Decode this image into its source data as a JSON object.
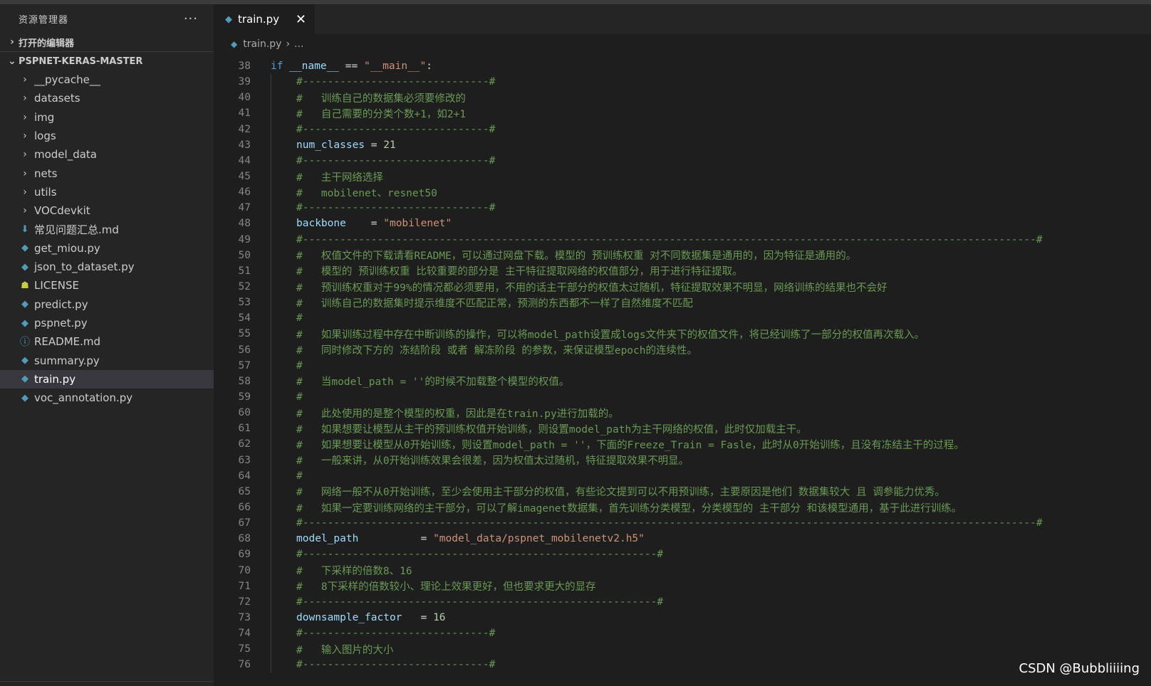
{
  "explorer": {
    "title": "资源管理器",
    "more": "···",
    "open_editors": "打开的编辑器",
    "project": "PSPNET-KERAS-MASTER",
    "items": [
      {
        "label": "__pycache__",
        "type": "folder"
      },
      {
        "label": "datasets",
        "type": "folder"
      },
      {
        "label": "img",
        "type": "folder"
      },
      {
        "label": "logs",
        "type": "folder"
      },
      {
        "label": "model_data",
        "type": "folder"
      },
      {
        "label": "nets",
        "type": "folder"
      },
      {
        "label": "utils",
        "type": "folder"
      },
      {
        "label": "VOCdevkit",
        "type": "folder"
      },
      {
        "label": "常见问题汇总.md",
        "type": "md"
      },
      {
        "label": "get_miou.py",
        "type": "py"
      },
      {
        "label": "json_to_dataset.py",
        "type": "py"
      },
      {
        "label": "LICENSE",
        "type": "license"
      },
      {
        "label": "predict.py",
        "type": "py"
      },
      {
        "label": "pspnet.py",
        "type": "py"
      },
      {
        "label": "README.md",
        "type": "info"
      },
      {
        "label": "summary.py",
        "type": "py"
      },
      {
        "label": "train.py",
        "type": "py",
        "active": true
      },
      {
        "label": "voc_annotation.py",
        "type": "py"
      }
    ]
  },
  "tab": {
    "label": "train.py",
    "close": "✕"
  },
  "breadcrumb": {
    "file": "train.py",
    "sep": "›",
    "rest": "..."
  },
  "code_lines": [
    {
      "n": "38",
      "indent": 0,
      "tokens": [
        [
          "k",
          "if "
        ],
        [
          "v",
          "__name__"
        ],
        [
          "o",
          " == "
        ],
        [
          "s",
          "\"__main__\""
        ],
        [
          "o",
          ":"
        ]
      ]
    },
    {
      "n": "39",
      "indent": 1,
      "tokens": [
        [
          "c",
          "#------------------------------#"
        ]
      ]
    },
    {
      "n": "40",
      "indent": 1,
      "tokens": [
        [
          "c",
          "#   训练自己的数据集必须要修改的"
        ]
      ]
    },
    {
      "n": "41",
      "indent": 1,
      "tokens": [
        [
          "c",
          "#   自己需要的分类个数+1，如2+1"
        ]
      ]
    },
    {
      "n": "42",
      "indent": 1,
      "tokens": [
        [
          "c",
          "#------------------------------#"
        ]
      ]
    },
    {
      "n": "43",
      "indent": 1,
      "tokens": [
        [
          "v",
          "num_classes"
        ],
        [
          "o",
          " = "
        ],
        [
          "n",
          "21"
        ]
      ]
    },
    {
      "n": "44",
      "indent": 1,
      "tokens": [
        [
          "c",
          "#------------------------------#"
        ]
      ]
    },
    {
      "n": "45",
      "indent": 1,
      "tokens": [
        [
          "c",
          "#   主干网络选择"
        ]
      ]
    },
    {
      "n": "46",
      "indent": 1,
      "tokens": [
        [
          "c",
          "#   mobilenet、resnet50"
        ]
      ]
    },
    {
      "n": "47",
      "indent": 1,
      "tokens": [
        [
          "c",
          "#------------------------------#"
        ]
      ]
    },
    {
      "n": "48",
      "indent": 1,
      "tokens": [
        [
          "v",
          "backbone"
        ],
        [
          "o",
          "    = "
        ],
        [
          "s",
          "\"mobilenet\""
        ]
      ]
    },
    {
      "n": "49",
      "indent": 1,
      "tokens": [
        [
          "c",
          "#----------------------------------------------------------------------------------------------------------------------#"
        ]
      ]
    },
    {
      "n": "50",
      "indent": 1,
      "tokens": [
        [
          "c",
          "#   权值文件的下载请看README，可以通过网盘下载。模型的 预训练权重 对不同数据集是通用的，因为特征是通用的。"
        ]
      ]
    },
    {
      "n": "51",
      "indent": 1,
      "tokens": [
        [
          "c",
          "#   模型的 预训练权重 比较重要的部分是 主干特征提取网络的权值部分，用于进行特征提取。"
        ]
      ]
    },
    {
      "n": "52",
      "indent": 1,
      "tokens": [
        [
          "c",
          "#   预训练权重对于99%的情况都必须要用，不用的话主干部分的权值太过随机，特征提取效果不明显，网络训练的结果也不会好"
        ]
      ]
    },
    {
      "n": "53",
      "indent": 1,
      "tokens": [
        [
          "c",
          "#   训练自己的数据集时提示维度不匹配正常，预测的东西都不一样了自然维度不匹配"
        ]
      ]
    },
    {
      "n": "54",
      "indent": 1,
      "tokens": [
        [
          "c",
          "#"
        ]
      ]
    },
    {
      "n": "55",
      "indent": 1,
      "tokens": [
        [
          "c",
          "#   如果训练过程中存在中断训练的操作，可以将model_path设置成logs文件夹下的权值文件，将已经训练了一部分的权值再次载入。"
        ]
      ]
    },
    {
      "n": "56",
      "indent": 1,
      "tokens": [
        [
          "c",
          "#   同时修改下方的 冻结阶段 或者 解冻阶段 的参数，来保证模型epoch的连续性。"
        ]
      ]
    },
    {
      "n": "57",
      "indent": 1,
      "tokens": [
        [
          "c",
          "#"
        ]
      ]
    },
    {
      "n": "58",
      "indent": 1,
      "tokens": [
        [
          "c",
          "#   当model_path = ''的时候不加载整个模型的权值。"
        ]
      ]
    },
    {
      "n": "59",
      "indent": 1,
      "tokens": [
        [
          "c",
          "#"
        ]
      ]
    },
    {
      "n": "60",
      "indent": 1,
      "tokens": [
        [
          "c",
          "#   此处使用的是整个模型的权重，因此是在train.py进行加载的。"
        ]
      ]
    },
    {
      "n": "61",
      "indent": 1,
      "tokens": [
        [
          "c",
          "#   如果想要让模型从主干的预训练权值开始训练，则设置model_path为主干网络的权值，此时仅加载主干。"
        ]
      ]
    },
    {
      "n": "62",
      "indent": 1,
      "tokens": [
        [
          "c",
          "#   如果想要让模型从0开始训练，则设置model_path = ''，下面的Freeze_Train = Fasle，此时从0开始训练，且没有冻结主干的过程。"
        ]
      ]
    },
    {
      "n": "63",
      "indent": 1,
      "tokens": [
        [
          "c",
          "#   一般来讲，从0开始训练效果会很差，因为权值太过随机，特征提取效果不明显。"
        ]
      ]
    },
    {
      "n": "64",
      "indent": 1,
      "tokens": [
        [
          "c",
          "#"
        ]
      ]
    },
    {
      "n": "65",
      "indent": 1,
      "tokens": [
        [
          "c",
          "#   网络一般不从0开始训练，至少会使用主干部分的权值，有些论文提到可以不用预训练，主要原因是他们 数据集较大 且 调参能力优秀。"
        ]
      ]
    },
    {
      "n": "66",
      "indent": 1,
      "tokens": [
        [
          "c",
          "#   如果一定要训练网络的主干部分，可以了解imagenet数据集，首先训练分类模型，分类模型的 主干部分 和该模型通用，基于此进行训练。"
        ]
      ]
    },
    {
      "n": "67",
      "indent": 1,
      "tokens": [
        [
          "c",
          "#----------------------------------------------------------------------------------------------------------------------#"
        ]
      ]
    },
    {
      "n": "68",
      "indent": 1,
      "tokens": [
        [
          "v",
          "model_path"
        ],
        [
          "o",
          "          = "
        ],
        [
          "s",
          "\"model_data/pspnet_mobilenetv2.h5\""
        ]
      ]
    },
    {
      "n": "69",
      "indent": 1,
      "tokens": [
        [
          "c",
          "#---------------------------------------------------------#"
        ]
      ]
    },
    {
      "n": "70",
      "indent": 1,
      "tokens": [
        [
          "c",
          "#   下采样的倍数8、16"
        ]
      ]
    },
    {
      "n": "71",
      "indent": 1,
      "tokens": [
        [
          "c",
          "#   8下采样的倍数较小、理论上效果更好，但也要求更大的显存"
        ]
      ]
    },
    {
      "n": "72",
      "indent": 1,
      "tokens": [
        [
          "c",
          "#---------------------------------------------------------#"
        ]
      ]
    },
    {
      "n": "73",
      "indent": 1,
      "tokens": [
        [
          "v",
          "downsample_factor"
        ],
        [
          "o",
          "   = "
        ],
        [
          "n",
          "16"
        ]
      ]
    },
    {
      "n": "74",
      "indent": 1,
      "tokens": [
        [
          "c",
          "#------------------------------#"
        ]
      ]
    },
    {
      "n": "75",
      "indent": 1,
      "tokens": [
        [
          "c",
          "#   输入图片的大小"
        ]
      ]
    },
    {
      "n": "76",
      "indent": 1,
      "tokens": [
        [
          "c",
          "#------------------------------#"
        ]
      ]
    }
  ],
  "watermark": "CSDN @Bubbliiiing"
}
